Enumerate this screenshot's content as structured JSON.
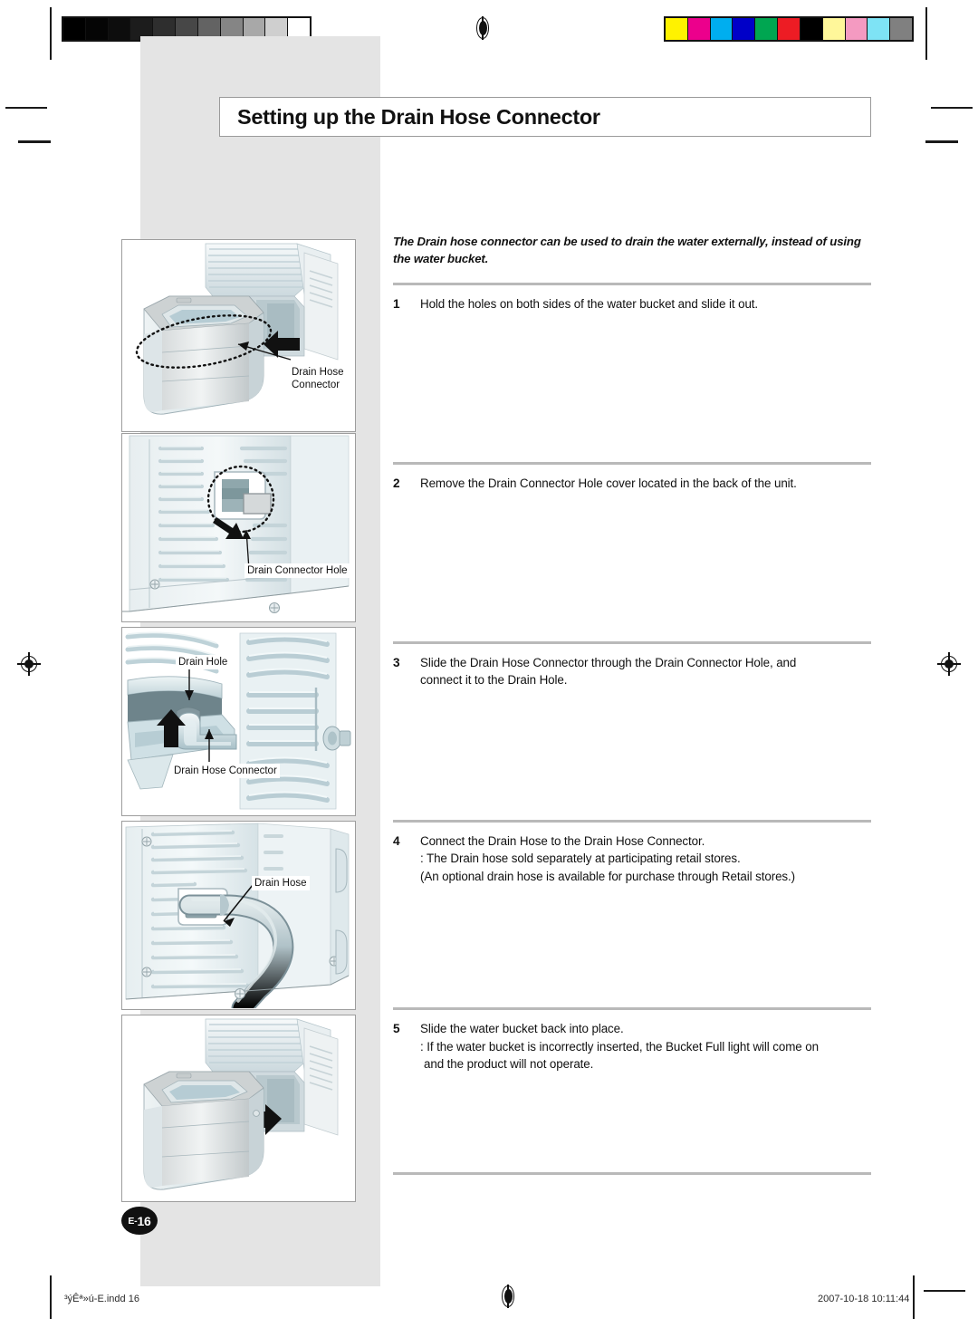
{
  "document": {
    "title": "Setting up the Drain Hose Connector",
    "page_label_prefix": "E-",
    "page_number": "16"
  },
  "instructions": {
    "intro": "The Drain hose connector can be used to drain the water externally, instead of using the water bucket.",
    "steps": [
      {
        "number": "1",
        "lines": [
          "Hold the holes on both sides of the water bucket and slide it out."
        ]
      },
      {
        "number": "2",
        "lines": [
          "Remove the Drain Connector Hole cover located in the back of the unit."
        ]
      },
      {
        "number": "3",
        "lines": [
          "Slide the Drain Hose Connector through the Drain Connector Hole, and",
          "connect it to the Drain Hole."
        ]
      },
      {
        "number": "4",
        "lines": [
          "Connect the Drain Hose to the Drain Hose Connector.",
          ": The Drain hose sold separately at participating retail stores.",
          "(An optional drain hose is available for purchase through Retail stores.)"
        ]
      },
      {
        "number": "5",
        "lines": [
          "Slide the water bucket back into place.",
          ": If the water bucket is incorrectly inserted, the Bucket Full light will come on",
          "and the product will not operate."
        ]
      }
    ]
  },
  "figures": [
    {
      "id": "figure-water-bucket-removal",
      "callouts": [
        "Drain Hose",
        "Connector"
      ]
    },
    {
      "id": "figure-drain-connector-hole",
      "callouts": [
        "Drain Connector Hole"
      ]
    },
    {
      "id": "figure-connector-to-drain-hole",
      "callouts": [
        "Drain Hole",
        "Drain Hose Connector"
      ]
    },
    {
      "id": "figure-drain-hose-attached",
      "callouts": [
        "Drain Hose"
      ]
    },
    {
      "id": "figure-bucket-reinsertion",
      "callouts": []
    }
  ],
  "print_marks": {
    "grayscale_swatches": [
      "#000000",
      "#050505",
      "#0d0d0d",
      "#1c1c1c",
      "#2e2e2e",
      "#474747",
      "#636363",
      "#858585",
      "#a8a8a8",
      "#cfcfcf",
      "#ffffff"
    ],
    "color_swatches": [
      "#fff200",
      "#ec008c",
      "#00aeef",
      "#0000c8",
      "#00a651",
      "#ed1c24",
      "#000000",
      "#fff79a",
      "#f49ac1",
      "#7ee3f5",
      "#808080"
    ]
  },
  "footer": {
    "filename": "³ýÊª»ú-E.indd   16",
    "timestamp": "2007-10-18   10:11:44"
  }
}
